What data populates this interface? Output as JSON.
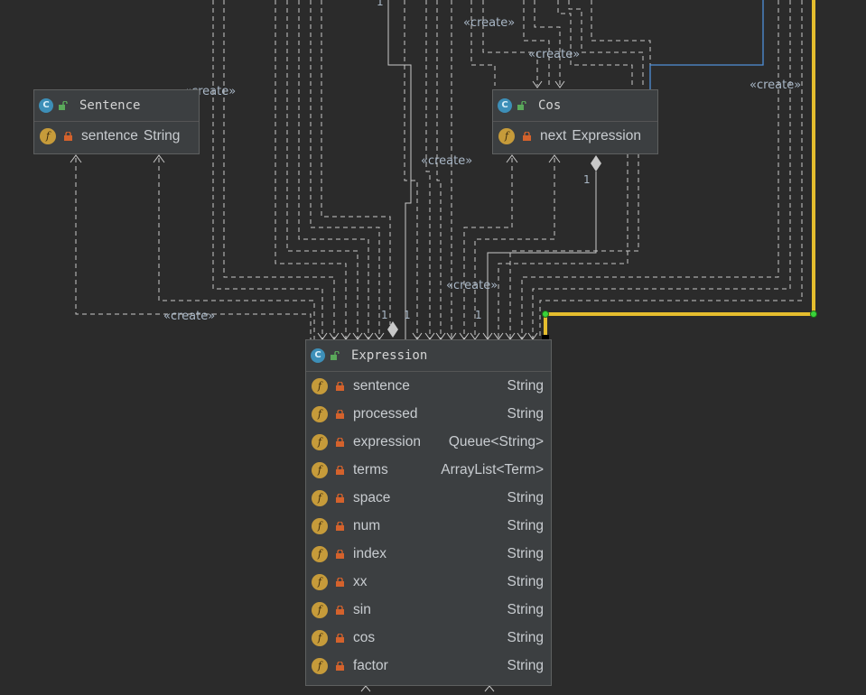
{
  "nodes": {
    "sentence": {
      "name": "Sentence",
      "kind_icon": "C",
      "fields": [
        {
          "icon": "f",
          "name": "sentence",
          "type": "String"
        }
      ]
    },
    "cos": {
      "name": "Cos",
      "kind_icon": "C",
      "fields": [
        {
          "icon": "f",
          "name": "next",
          "type": "Expression"
        }
      ]
    },
    "expression": {
      "name": "Expression",
      "kind_icon": "C",
      "fields": [
        {
          "icon": "f",
          "name": "sentence",
          "type": "String"
        },
        {
          "icon": "f",
          "name": "processed",
          "type": "String"
        },
        {
          "icon": "f",
          "name": "expression",
          "type": "Queue<String>"
        },
        {
          "icon": "f",
          "name": "terms",
          "type": "ArrayList<Term>"
        },
        {
          "icon": "f",
          "name": "space",
          "type": "String"
        },
        {
          "icon": "f",
          "name": "num",
          "type": "String"
        },
        {
          "icon": "f",
          "name": "index",
          "type": "String"
        },
        {
          "icon": "f",
          "name": "xx",
          "type": "String"
        },
        {
          "icon": "f",
          "name": "sin",
          "type": "String"
        },
        {
          "icon": "f",
          "name": "cos",
          "type": "String"
        },
        {
          "icon": "f",
          "name": "factor",
          "type": "String"
        }
      ]
    }
  },
  "edge_labels": {
    "create_1": "«create»",
    "create_2": "«create»",
    "create_3": "«create»",
    "create_4": "«create»",
    "create_5": "«create»",
    "create_6": "«create»",
    "create_7": "«create»"
  },
  "multiplicities": {
    "m1": "1",
    "m2": "1",
    "m3": "1",
    "m4": "1",
    "m5": "1"
  },
  "colors": {
    "background": "#2b2b2b",
    "node_fill": "#3c3f41",
    "selected_edge": "#e5bd2e",
    "blue_edge": "#4f8fd8"
  }
}
